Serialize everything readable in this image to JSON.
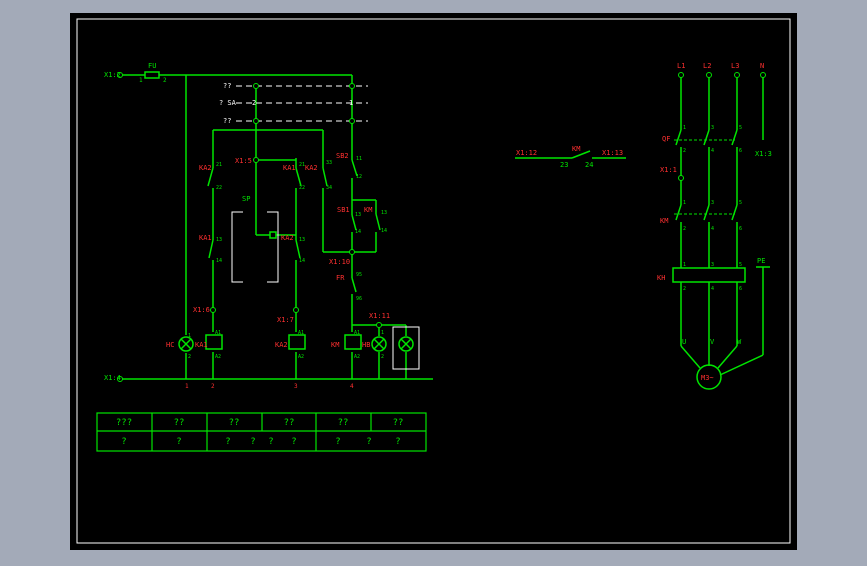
{
  "colors": {
    "background": "#a3aab8",
    "paper": "#000000",
    "frame": "#ffffff",
    "wire": "#00e400",
    "label": "#ff3030",
    "dashed": "#ffffff"
  },
  "labels": {
    "x1_2": "X1:2",
    "fu": "FU",
    "fu_pin1": "1",
    "fu_pin2": "2",
    "q1": "??",
    "sa": "? SA",
    "sa_pin2": "2",
    "sa_pin1": "1",
    "q2": "??",
    "sa_pin_b": "2",
    "ka2_top": "KA2",
    "pin21a": "21",
    "pin22a": "22",
    "x1_5": "X1:5",
    "ka1_top": "KA1",
    "ka2_mid": "KA2",
    "pin21b": "21",
    "pin22b": "22",
    "pin33": "33",
    "pin34": "34",
    "sb2": "SB2",
    "pin11a": "11",
    "pin12a": "12",
    "sp": "SP",
    "ka1_low": "KA1",
    "pin13a": "13",
    "pin14a": "14",
    "ka2_low": "KA2",
    "pin13b": "13",
    "pin14b": "14",
    "sb1": "SB1",
    "pin13c": "13",
    "pin14c": "14",
    "km_hold": "KM",
    "pin13d": "13",
    "pin14d": "14",
    "x1_10": "X1:10",
    "fr": "FR",
    "pin95": "95",
    "pin96": "96",
    "x1_6": "X1:6",
    "x1_7": "X1:7",
    "x1_11": "X1:11",
    "pin_a1a": "A1",
    "pin_a2a": "A2",
    "pin_a1b": "A1",
    "pin_a2b": "A2",
    "pin_a1c": "A1",
    "pin_a2c": "A2",
    "hl_label": "HC",
    "ka1_coil": "KA1",
    "ka2_coil": "KA2",
    "km_coil": "KM",
    "hl2": "HB",
    "lamp_pin1": "1",
    "lamp_pin2": "2",
    "lamp_pin_b": "2",
    "lamp_pin_c": "1",
    "x1_4": "X1:4",
    "bus1": "1",
    "bus2": "2",
    "bus3": "3",
    "bus4": "4",
    "mid_x1_12": "X1:12",
    "mid_km": "KM",
    "mid_x1_13": "X1:13",
    "mid_23": "23",
    "mid_24": "24",
    "l1": "L1",
    "l2": "L2",
    "l3": "L3",
    "n": "N",
    "qf": "QF",
    "x1_1": "X1:1",
    "x1_3": "X1:3",
    "km_main": "KM",
    "kh": "KH",
    "pe": "PE",
    "u": "U",
    "v": "V",
    "w": "W",
    "motor": "M3~",
    "qf_p1": "1",
    "qf_p2": "3",
    "qf_p3": "5",
    "qf_p4": "2",
    "qf_p5": "4",
    "qf_p6": "6",
    "km_p1": "1",
    "km_p2": "3",
    "km_p3": "5",
    "km_p4": "2",
    "km_p5": "4",
    "km_p6": "6",
    "kh_p1": "1",
    "kh_p2": "3",
    "kh_p3": "5",
    "kh_p4": "2",
    "kh_p5": "4",
    "kh_p6": "6"
  },
  "table": {
    "header": [
      "???",
      "??",
      "??",
      "??",
      "??",
      "??"
    ],
    "row": [
      "?",
      "?",
      "?",
      "?",
      "?",
      "?",
      "?",
      "?",
      "?"
    ]
  }
}
